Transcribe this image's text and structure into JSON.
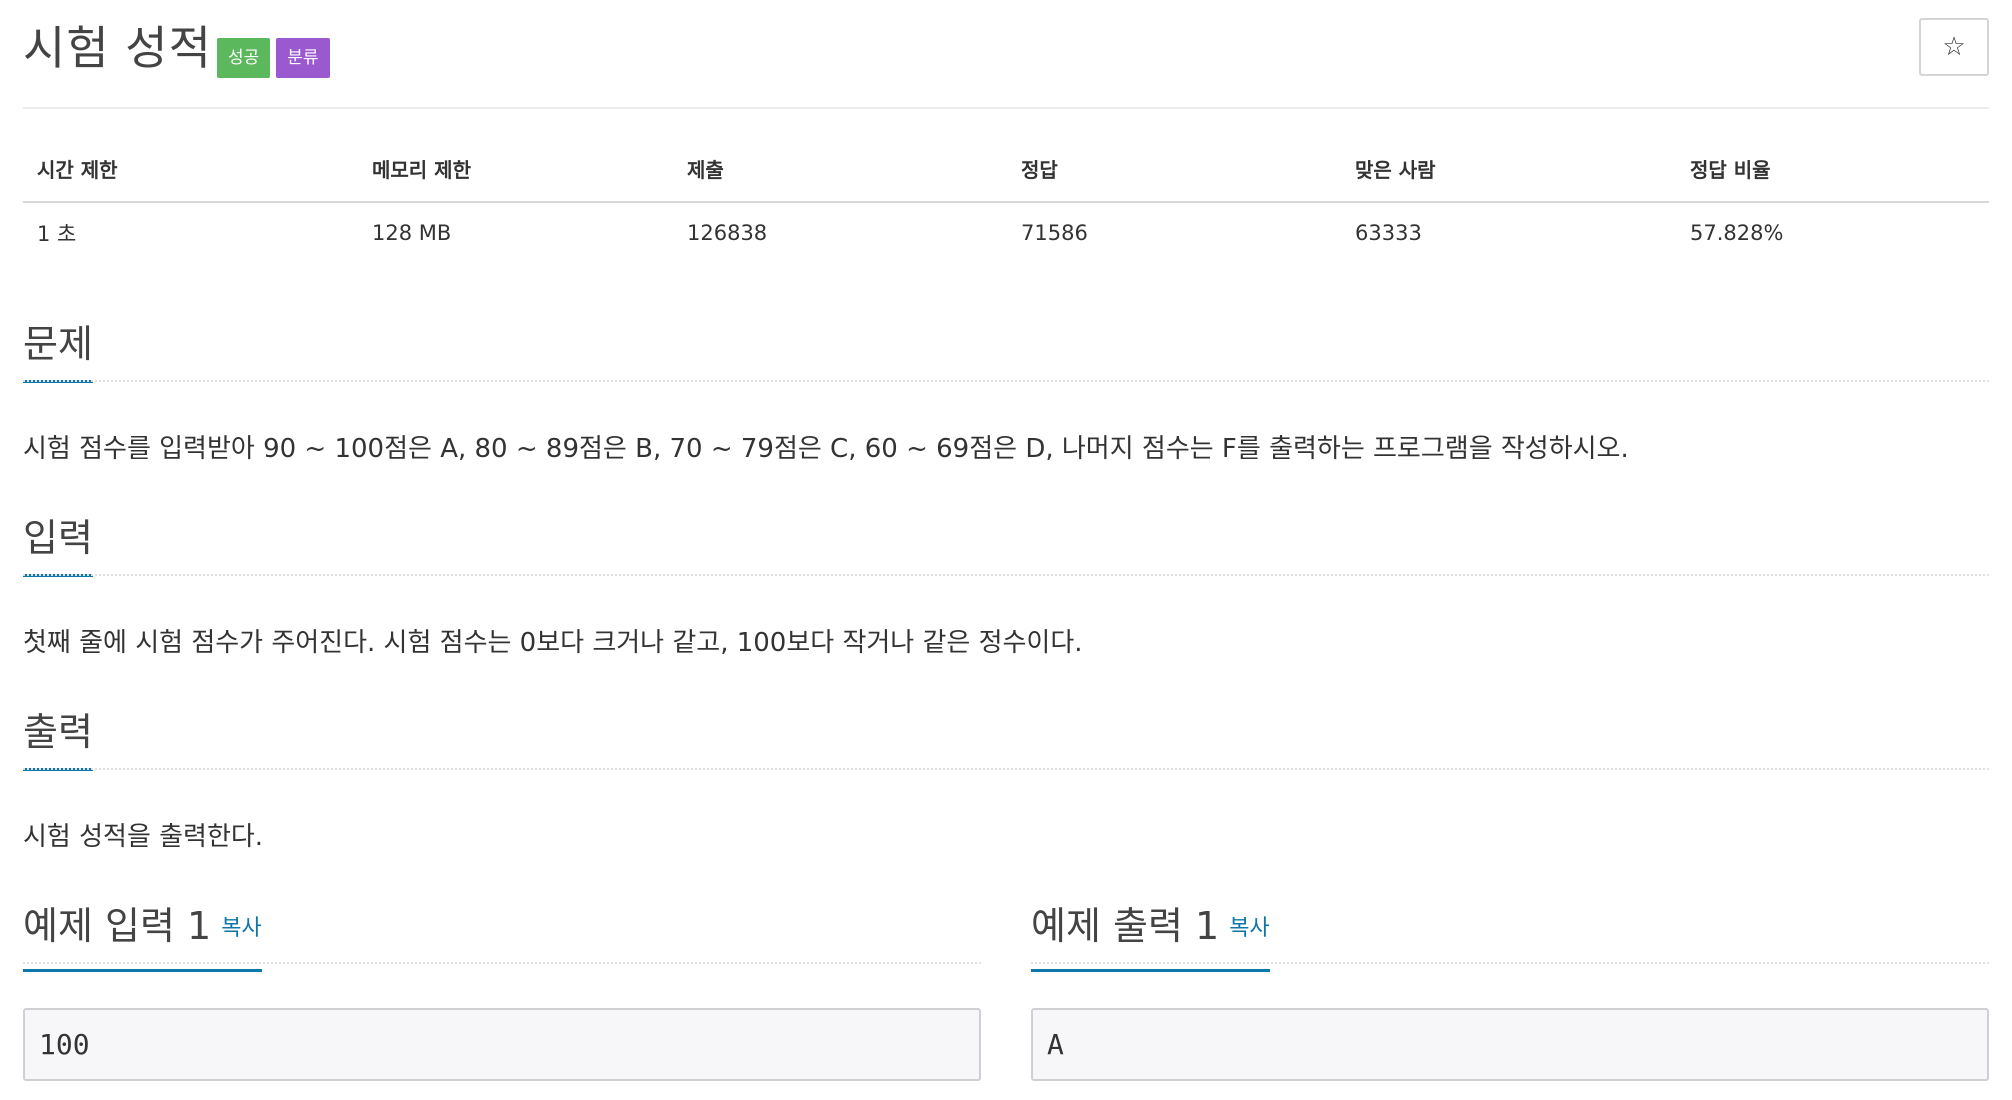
{
  "problem": {
    "title": "시험 성적",
    "labels": {
      "success": "성공",
      "category": "분류"
    },
    "star_icon": "☆"
  },
  "info": {
    "headers": [
      "시간 제한",
      "메모리 제한",
      "제출",
      "정답",
      "맞은 사람",
      "정답 비율"
    ],
    "values": [
      "1 초",
      "128 MB",
      "126838",
      "71586",
      "63333",
      "57.828%"
    ]
  },
  "sections": {
    "description": {
      "title": "문제",
      "text": "시험 점수를 입력받아 90 ~ 100점은 A, 80 ~ 89점은 B, 70 ~ 79점은 C, 60 ~ 69점은 D, 나머지 점수는 F를 출력하는 프로그램을 작성하시오."
    },
    "input": {
      "title": "입력",
      "text": "첫째 줄에 시험 점수가 주어진다. 시험 점수는 0보다 크거나 같고, 100보다 작거나 같은 정수이다."
    },
    "output": {
      "title": "출력",
      "text": "시험 성적을 출력한다."
    }
  },
  "samples": {
    "input": {
      "title": "예제 입력 1",
      "copy_label": "복사",
      "content": "100"
    },
    "output": {
      "title": "예제 출력 1",
      "copy_label": "복사",
      "content": "A"
    }
  },
  "colors": {
    "accent": "#0e76a8",
    "success": "#5cb85c",
    "category": "#9b59d0"
  }
}
